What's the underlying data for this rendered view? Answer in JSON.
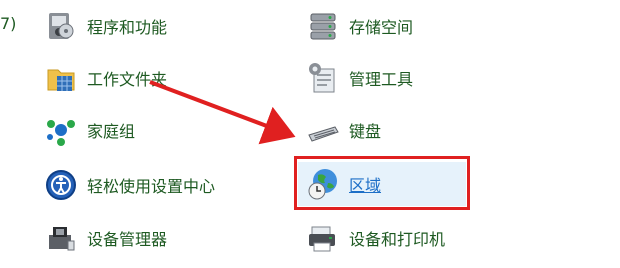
{
  "left_column": [
    {
      "label": "程序和功能",
      "icon": "programs-features-icon"
    },
    {
      "label": "工作文件夹",
      "icon": "work-folders-icon"
    },
    {
      "label": "家庭组",
      "icon": "homegroup-icon"
    },
    {
      "label": "轻松使用设置中心",
      "icon": "ease-of-access-icon"
    },
    {
      "label": "设备管理器",
      "icon": "device-manager-icon"
    }
  ],
  "right_column": [
    {
      "label": "存储空间",
      "icon": "storage-spaces-icon"
    },
    {
      "label": "管理工具",
      "icon": "admin-tools-icon"
    },
    {
      "label": "键盘",
      "icon": "keyboard-icon"
    },
    {
      "label": "区域",
      "icon": "region-globe-icon",
      "highlighted": true
    },
    {
      "label": "设备和打印机",
      "icon": "devices-printers-icon"
    }
  ],
  "left_edge_fragment": "7)",
  "colors": {
    "link_green": "#1e5a22",
    "highlight_bg": "#e6f2fb",
    "annotation_red": "#e02020"
  }
}
